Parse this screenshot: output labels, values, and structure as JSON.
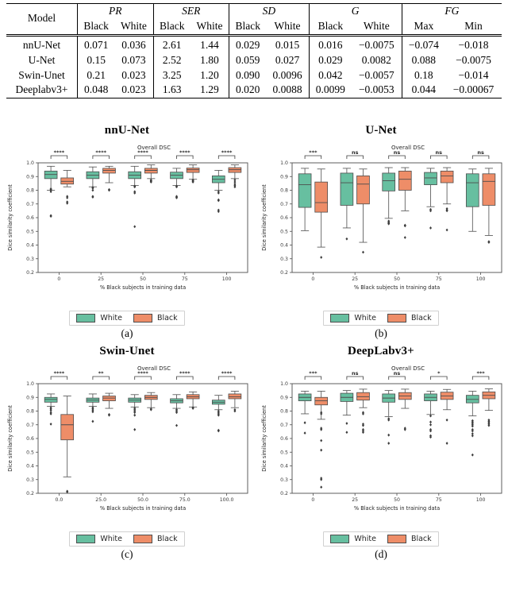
{
  "table": {
    "col_model": "Model",
    "groups": [
      {
        "name": "PR",
        "subs": [
          "Black",
          "White"
        ]
      },
      {
        "name": "SER",
        "subs": [
          "Black",
          "White"
        ]
      },
      {
        "name": "SD",
        "subs": [
          "Black",
          "White"
        ]
      },
      {
        "name": "G",
        "subs": [
          "Black",
          "White"
        ]
      },
      {
        "name": "FG",
        "subs": [
          "Max",
          "Min"
        ]
      }
    ],
    "rows": [
      {
        "model": "nnU-Net",
        "cells": [
          "0.071",
          "0.036",
          "2.61",
          "1.44",
          "0.029",
          "0.015",
          "0.016",
          "−0.0075",
          "−0.074",
          "−0.018"
        ]
      },
      {
        "model": "U-Net",
        "cells": [
          "0.15",
          "0.073",
          "2.52",
          "1.80",
          "0.059",
          "0.027",
          "0.029",
          "0.0082",
          "0.088",
          "−0.0075"
        ]
      },
      {
        "model": "Swin-Unet",
        "cells": [
          "0.21",
          "0.023",
          "3.25",
          "1.20",
          "0.090",
          "0.0096",
          "0.042",
          "−0.0057",
          "0.18",
          "−0.014"
        ]
      },
      {
        "model": "Deeplabv3+",
        "cells": [
          "0.048",
          "0.023",
          "1.63",
          "1.29",
          "0.020",
          "0.0088",
          "0.0099",
          "−0.0053",
          "0.044",
          "−0.00067"
        ]
      }
    ]
  },
  "colors": {
    "white_group": "#67bfa0",
    "black_group": "#ee8d68",
    "edge": "#4d4d4d",
    "axis": "#4d4d4d",
    "text": "#262626"
  },
  "legend": {
    "white_label": "White",
    "black_label": "Black"
  },
  "chart_data": [
    {
      "id": "a",
      "type": "box",
      "title": "nnU-Net",
      "caption": "(a)",
      "plot_title": "Overall DSC",
      "xlabel": "% Black subjects in training data",
      "ylabel": "Dice similarity coefficient",
      "ylim": [
        0.2,
        1.0
      ],
      "yticks": [
        "0.2",
        "0.3",
        "0.4",
        "0.5",
        "0.6",
        "0.7",
        "0.8",
        "0.9",
        "1.0"
      ],
      "categories": [
        "0",
        "25",
        "50",
        "75",
        "100"
      ],
      "significance": [
        "****",
        "****",
        "****",
        "****",
        "****"
      ],
      "series": [
        {
          "name": "White",
          "boxes": [
            {
              "whislo": 0.8,
              "q1": 0.885,
              "med": 0.915,
              "q3": 0.94,
              "whishi": 0.975,
              "fliers": [
                0.79,
                0.8,
                0.805,
                0.81,
                0.61,
                0.615
              ]
            },
            {
              "whislo": 0.825,
              "q1": 0.885,
              "med": 0.91,
              "q3": 0.935,
              "whishi": 0.97,
              "fliers": [
                0.82,
                0.815,
                0.8,
                0.755,
                0.75
              ]
            },
            {
              "whislo": 0.835,
              "q1": 0.885,
              "med": 0.91,
              "q3": 0.935,
              "whishi": 0.975,
              "fliers": [
                0.83,
                0.825,
                0.79,
                0.78,
                0.535
              ]
            },
            {
              "whislo": 0.835,
              "q1": 0.885,
              "med": 0.91,
              "q3": 0.932,
              "whishi": 0.96,
              "fliers": [
                0.83,
                0.825,
                0.755,
                0.75,
                0.745
              ]
            },
            {
              "whislo": 0.8,
              "q1": 0.855,
              "med": 0.88,
              "q3": 0.905,
              "whishi": 0.945,
              "fliers": [
                0.79,
                0.78,
                0.73,
                0.725,
                0.655,
                0.645
              ]
            }
          ]
        },
        {
          "name": "Black",
          "boxes": [
            {
              "whislo": 0.825,
              "q1": 0.845,
              "med": 0.865,
              "q3": 0.89,
              "whishi": 0.945,
              "fliers": [
                0.755,
                0.745,
                0.715,
                0.705
              ]
            },
            {
              "whislo": 0.855,
              "q1": 0.925,
              "med": 0.945,
              "q3": 0.96,
              "whishi": 0.975,
              "fliers": [
                0.8,
                0.805
              ]
            },
            {
              "whislo": 0.885,
              "q1": 0.925,
              "med": 0.945,
              "q3": 0.96,
              "whishi": 0.985,
              "fliers": [
                0.875,
                0.87,
                0.865,
                0.86
              ]
            },
            {
              "whislo": 0.88,
              "q1": 0.93,
              "med": 0.95,
              "q3": 0.962,
              "whishi": 0.985,
              "fliers": [
                0.875,
                0.87,
                0.865,
                0.86
              ]
            },
            {
              "whislo": 0.885,
              "q1": 0.93,
              "med": 0.95,
              "q3": 0.965,
              "whishi": 0.985,
              "fliers": [
                0.875,
                0.86,
                0.845,
                0.835,
                0.825
              ]
            }
          ]
        }
      ]
    },
    {
      "id": "b",
      "type": "box",
      "title": "U-Net",
      "caption": "(b)",
      "plot_title": "Overall DSC",
      "xlabel": "% Black subjects in training data",
      "ylabel": "Dice similarity coefficient",
      "ylim": [
        0.2,
        1.0
      ],
      "yticks": [
        "0.2",
        "0.3",
        "0.4",
        "0.5",
        "0.6",
        "0.7",
        "0.8",
        "0.9",
        "1.0"
      ],
      "categories": [
        "0",
        "25",
        "50",
        "75",
        "100"
      ],
      "significance": [
        "***",
        "ns",
        "ns",
        "ns",
        "ns"
      ],
      "series": [
        {
          "name": "White",
          "boxes": [
            {
              "whislo": 0.505,
              "q1": 0.675,
              "med": 0.84,
              "q3": 0.92,
              "whishi": 0.96,
              "fliers": []
            },
            {
              "whislo": 0.525,
              "q1": 0.69,
              "med": 0.855,
              "q3": 0.925,
              "whishi": 0.96,
              "fliers": [
                0.445
              ]
            },
            {
              "whislo": 0.595,
              "q1": 0.795,
              "med": 0.87,
              "q3": 0.925,
              "whishi": 0.965,
              "fliers": [
                0.575,
                0.565,
                0.56,
                0.555
              ]
            },
            {
              "whislo": 0.68,
              "q1": 0.84,
              "med": 0.89,
              "q3": 0.93,
              "whishi": 0.96,
              "fliers": [
                0.66,
                0.65,
                0.525
              ]
            },
            {
              "whislo": 0.5,
              "q1": 0.68,
              "med": 0.855,
              "q3": 0.92,
              "whishi": 0.955,
              "fliers": []
            }
          ]
        },
        {
          "name": "Black",
          "boxes": [
            {
              "whislo": 0.385,
              "q1": 0.64,
              "med": 0.71,
              "q3": 0.86,
              "whishi": 0.955,
              "fliers": [
                0.31
              ]
            },
            {
              "whislo": 0.42,
              "q1": 0.7,
              "med": 0.845,
              "q3": 0.905,
              "whishi": 0.955,
              "fliers": [
                0.348
              ]
            },
            {
              "whislo": 0.65,
              "q1": 0.8,
              "med": 0.88,
              "q3": 0.94,
              "whishi": 0.965,
              "fliers": [
                0.545,
                0.54,
                0.455
              ]
            },
            {
              "whislo": 0.7,
              "q1": 0.855,
              "med": 0.905,
              "q3": 0.94,
              "whishi": 0.965,
              "fliers": [
                0.665,
                0.655,
                0.65,
                0.51
              ]
            },
            {
              "whislo": 0.47,
              "q1": 0.69,
              "med": 0.865,
              "q3": 0.92,
              "whishi": 0.96,
              "fliers": [
                0.425,
                0.42
              ]
            }
          ]
        }
      ]
    },
    {
      "id": "c",
      "type": "box",
      "title": "Swin-Unet",
      "caption": "(c)",
      "plot_title": "Overall DSC",
      "xlabel": "% Black subjects in training data",
      "ylabel": "Dice similarity coefficient",
      "ylim": [
        0.2,
        1.0
      ],
      "yticks": [
        "0.2",
        "0.3",
        "0.4",
        "0.5",
        "0.6",
        "0.7",
        "0.8",
        "0.9",
        "1.0"
      ],
      "categories": [
        "0.0",
        "25.0",
        "50.0",
        "75.0",
        "100.0"
      ],
      "significance": [
        "****",
        "**",
        "****",
        "****",
        "****"
      ],
      "series": [
        {
          "name": "White",
          "boxes": [
            {
              "whislo": 0.835,
              "q1": 0.865,
              "med": 0.885,
              "q3": 0.9,
              "whishi": 0.925,
              "fliers": [
                0.825,
                0.815,
                0.805,
                0.79,
                0.78,
                0.705
              ]
            },
            {
              "whislo": 0.835,
              "q1": 0.865,
              "med": 0.88,
              "q3": 0.895,
              "whishi": 0.925,
              "fliers": [
                0.825,
                0.815,
                0.805,
                0.795,
                0.725
              ]
            },
            {
              "whislo": 0.83,
              "q1": 0.865,
              "med": 0.88,
              "q3": 0.895,
              "whishi": 0.92,
              "fliers": [
                0.82,
                0.81,
                0.8,
                0.79,
                0.77,
                0.665
              ]
            },
            {
              "whislo": 0.82,
              "q1": 0.86,
              "med": 0.875,
              "q3": 0.89,
              "whishi": 0.92,
              "fliers": [
                0.81,
                0.8,
                0.79,
                0.695
              ]
            },
            {
              "whislo": 0.81,
              "q1": 0.85,
              "med": 0.865,
              "q3": 0.88,
              "whishi": 0.915,
              "fliers": [
                0.8,
                0.79,
                0.78,
                0.77,
                0.66,
                0.655
              ]
            }
          ]
        },
        {
          "name": "Black",
          "boxes": [
            {
              "whislo": 0.32,
              "q1": 0.59,
              "med": 0.7,
              "q3": 0.775,
              "whishi": 0.91,
              "fliers": [
                0.215,
                0.21
              ]
            },
            {
              "whislo": 0.82,
              "q1": 0.875,
              "med": 0.895,
              "q3": 0.91,
              "whishi": 0.93,
              "fliers": [
                0.775,
                0.77
              ]
            },
            {
              "whislo": 0.825,
              "q1": 0.885,
              "med": 0.9,
              "q3": 0.915,
              "whishi": 0.935,
              "fliers": [
                0.815,
                0.81
              ]
            },
            {
              "whislo": 0.83,
              "q1": 0.89,
              "med": 0.905,
              "q3": 0.92,
              "whishi": 0.94,
              "fliers": [
                0.825,
                0.82
              ]
            },
            {
              "whislo": 0.825,
              "q1": 0.89,
              "med": 0.905,
              "q3": 0.925,
              "whishi": 0.945,
              "fliers": [
                0.81,
                0.8
              ]
            }
          ]
        }
      ]
    },
    {
      "id": "d",
      "type": "box",
      "title": "DeepLabv3+",
      "caption": "(d)",
      "plot_title": "Overall DSC",
      "xlabel": "% Black subjects in training data",
      "ylabel": "Dice similarity coefficient",
      "ylim": [
        0.2,
        1.0
      ],
      "yticks": [
        "0.2",
        "0.3",
        "0.4",
        "0.5",
        "0.6",
        "0.7",
        "0.8",
        "0.9",
        "1.0"
      ],
      "categories": [
        "0",
        "25",
        "50",
        "75",
        "100"
      ],
      "significance": [
        "***",
        "ns",
        "ns",
        "*",
        "***"
      ],
      "series": [
        {
          "name": "White",
          "boxes": [
            {
              "whislo": 0.78,
              "q1": 0.875,
              "med": 0.9,
              "q3": 0.925,
              "whishi": 0.945,
              "fliers": [
                0.715,
                0.64
              ]
            },
            {
              "whislo": 0.77,
              "q1": 0.87,
              "med": 0.9,
              "q3": 0.93,
              "whishi": 0.95,
              "fliers": [
                0.71,
                0.645
              ]
            },
            {
              "whislo": 0.76,
              "q1": 0.865,
              "med": 0.895,
              "q3": 0.925,
              "whishi": 0.95,
              "fliers": [
                0.745,
                0.735,
                0.625,
                0.565
              ]
            },
            {
              "whislo": 0.775,
              "q1": 0.875,
              "med": 0.9,
              "q3": 0.925,
              "whishi": 0.945,
              "fliers": [
                0.765,
                0.72,
                0.7,
                0.665,
                0.655,
                0.62,
                0.61
              ]
            },
            {
              "whislo": 0.765,
              "q1": 0.86,
              "med": 0.885,
              "q3": 0.915,
              "whishi": 0.945,
              "fliers": [
                0.73,
                0.72,
                0.71,
                0.7,
                0.69,
                0.665,
                0.655,
                0.635,
                0.62,
                0.48
              ]
            }
          ]
        },
        {
          "name": "Black",
          "boxes": [
            {
              "whislo": 0.74,
              "q1": 0.845,
              "med": 0.875,
              "q3": 0.9,
              "whishi": 0.945,
              "fliers": [
                0.79,
                0.78,
                0.675,
                0.665,
                0.585,
                0.515,
                0.31,
                0.3,
                0.245
              ]
            },
            {
              "whislo": 0.825,
              "q1": 0.88,
              "med": 0.905,
              "q3": 0.935,
              "whishi": 0.96,
              "fliers": [
                0.79,
                0.78,
                0.705,
                0.695,
                0.665,
                0.655,
                0.645
              ]
            },
            {
              "whislo": 0.82,
              "q1": 0.885,
              "med": 0.91,
              "q3": 0.935,
              "whishi": 0.96,
              "fliers": [
                0.675,
                0.665
              ]
            },
            {
              "whislo": 0.81,
              "q1": 0.885,
              "med": 0.91,
              "q3": 0.938,
              "whishi": 0.958,
              "fliers": [
                0.735,
                0.565
              ]
            },
            {
              "whislo": 0.805,
              "q1": 0.89,
              "med": 0.915,
              "q3": 0.94,
              "whishi": 0.962,
              "fliers": [
                0.735,
                0.725,
                0.715,
                0.705,
                0.695
              ]
            }
          ]
        }
      ]
    }
  ]
}
